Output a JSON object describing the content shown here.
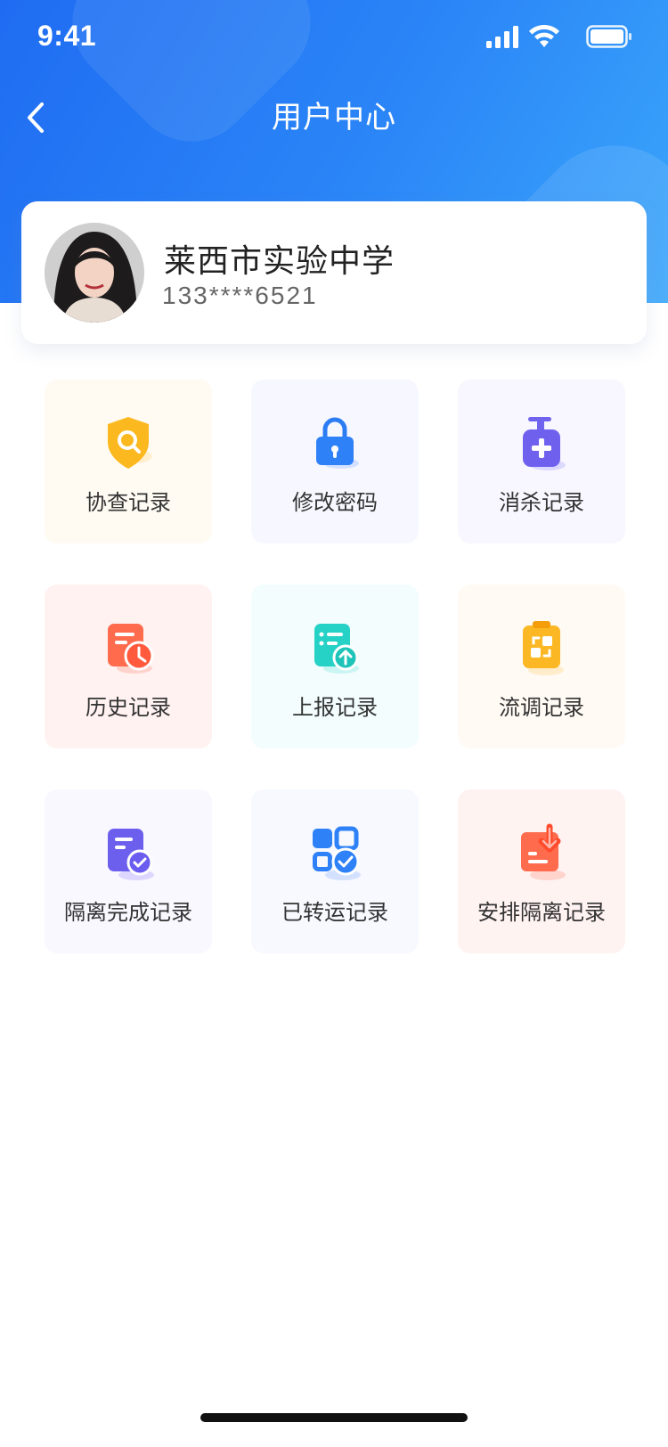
{
  "status_bar": {
    "time": "9:41"
  },
  "nav": {
    "title": "用户中心"
  },
  "profile": {
    "name": "莱西市实验中学",
    "phone": "133****6521"
  },
  "menu": [
    {
      "label": "协查记录",
      "icon": "shield-search-icon",
      "bg": "#fffbf3"
    },
    {
      "label": "修改密码",
      "icon": "lock-icon",
      "bg": "#f7f8ff"
    },
    {
      "label": "消杀记录",
      "icon": "sanitizer-bottle-icon",
      "bg": "#f8f7ff"
    },
    {
      "label": "历史记录",
      "icon": "history-clock-icon",
      "bg": "#fff2f1"
    },
    {
      "label": "上报记录",
      "icon": "report-upload-icon",
      "bg": "#f3fdfd"
    },
    {
      "label": "流调记录",
      "icon": "clipboard-icon",
      "bg": "#fffaf4"
    },
    {
      "label": "隔离完成记录",
      "icon": "document-check-icon",
      "bg": "#f9f8ff"
    },
    {
      "label": "已转运记录",
      "icon": "grid-check-icon",
      "bg": "#f7f9ff"
    },
    {
      "label": "安排隔离记录",
      "icon": "document-download-icon",
      "bg": "#fff3f2"
    }
  ],
  "colors": {
    "header_gradient_start": "#1f6cf2",
    "header_gradient_end": "#3aa6fb",
    "text_primary": "#222222",
    "text_secondary": "#666666"
  }
}
